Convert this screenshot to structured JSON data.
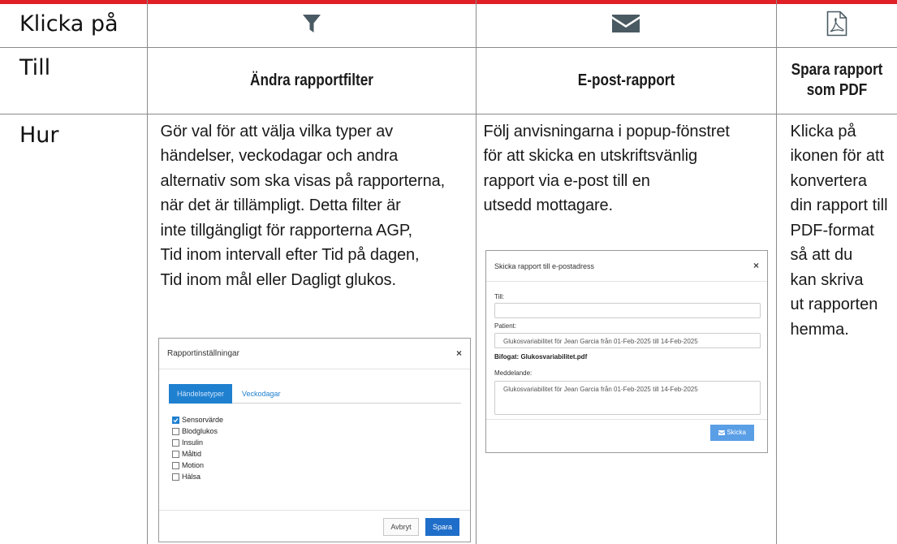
{
  "header": {
    "row_label": "Klicka på",
    "icons": [
      "filter-icon",
      "envelope-icon",
      "pdf-icon"
    ]
  },
  "till": {
    "row_label": "Till",
    "filter_title": "Ändra rapportfilter",
    "email_title": "E-post-rapport",
    "pdf_title_line1": "Spara rapport",
    "pdf_title_line2": "som PDF"
  },
  "hur": {
    "row_label": "Hur",
    "filter_lines": [
      "Gör val för att välja vilka typer av",
      "händelser, veckodagar och andra",
      "alternativ som ska visas på rapporterna,",
      "när det är tillämpligt. Detta filter är",
      "inte tillgängligt för rapporterna AGP,",
      "Tid inom intervall efter Tid på dagen,",
      "Tid inom mål eller Dagligt glukos."
    ],
    "email_lines": [
      "Följ anvisningarna i popup-fönstret",
      "för att skicka en utskriftsvänlig",
      "rapport via e-post till en",
      "utsedd mottagare."
    ],
    "pdf_lines": [
      "Klicka på",
      "ikonen för att",
      "konvertera",
      "din rapport till",
      "PDF-format",
      "så att du",
      "kan skriva",
      "ut rapporten",
      "hemma."
    ]
  },
  "settings_dialog": {
    "title": "Rapportinställningar",
    "close": "×",
    "tab_active": "Händelsetyper",
    "tab_inactive": "Veckodagar",
    "options": [
      {
        "label": "Sensorvärde",
        "checked": true
      },
      {
        "label": "Blodglukos",
        "checked": false
      },
      {
        "label": "Insulin",
        "checked": false
      },
      {
        "label": "Måltid",
        "checked": false
      },
      {
        "label": "Motion",
        "checked": false
      },
      {
        "label": "Hälsa",
        "checked": false
      }
    ],
    "cancel_label": "Avbryt",
    "save_label": "Spara"
  },
  "email_dialog": {
    "title": "Skicka rapport till e-postadress",
    "close": "×",
    "to_label": "Till:",
    "to_value": "",
    "patient_label": "Patient:",
    "patient_value": "Glukosvariabilitet för Jean Garcia från 01-Feb-2025 till 14-Feb-2025",
    "attachment_label": "Bifogat: Glukosvariabilitet.pdf",
    "message_label": "Meddelande:",
    "message_value": "Glukosvariabilitet för Jean Garcia från 01-Feb-2025 till 14-Feb-2025",
    "send_label": "Skicka"
  },
  "colors": {
    "accent_blue": "#1f80d0",
    "icon_gray": "#4a5a62",
    "top_rule_red": "#e01f26"
  }
}
